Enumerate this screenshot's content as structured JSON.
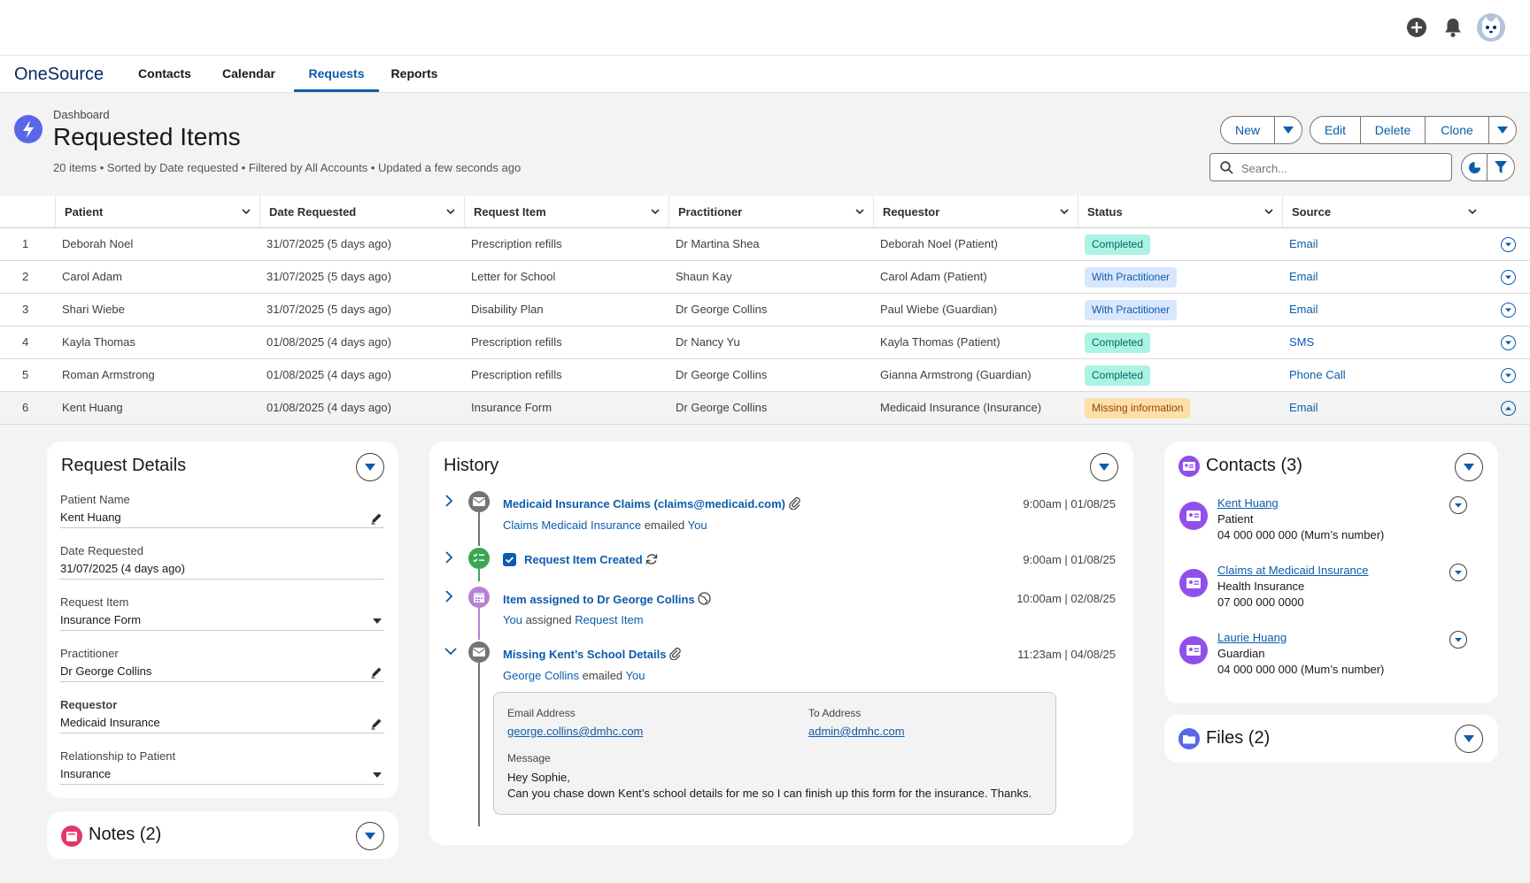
{
  "app": {
    "name": "OneSource"
  },
  "nav": {
    "tabs": [
      "Contacts",
      "Calendar",
      "Requests",
      "Reports"
    ],
    "active": "Requests"
  },
  "header_icons": [
    "add-icon",
    "bell-icon",
    "avatar"
  ],
  "page": {
    "breadcrumb": "Dashboard",
    "title": "Requested Items",
    "subtitle": "20 items • Sorted by Date requested  • Filtered by All Accounts • Updated a few seconds ago"
  },
  "actions": {
    "new": "New",
    "edit": "Edit",
    "delete": "Delete",
    "clone": "Clone"
  },
  "search": {
    "placeholder": "Search..."
  },
  "table": {
    "columns": [
      "Patient",
      "Date Requested",
      "Request Item",
      "Practitioner",
      "Requestor",
      "Status",
      "Source"
    ],
    "rows": [
      {
        "num": "1",
        "patient": "Deborah Noel",
        "date": "31/07/2025 (5 days ago)",
        "item": "Prescription refills",
        "practitioner": "Dr Martina Shea",
        "requestor": "Deborah Noel (Patient)",
        "status": "Completed",
        "source": "Email"
      },
      {
        "num": "2",
        "patient": "Carol Adam",
        "date": "31/07/2025 (5 days ago)",
        "item": "Letter for School",
        "practitioner": "Shaun Kay",
        "requestor": "Carol Adam (Patient)",
        "status": "With Practitioner",
        "source": "Email"
      },
      {
        "num": "3",
        "patient": "Shari Wiebe",
        "date": "31/07/2025 (5 days ago)",
        "item": "Disability Plan",
        "practitioner": "Dr George Collins",
        "requestor": "Paul Wiebe (Guardian)",
        "status": "With Practitioner",
        "source": "Email"
      },
      {
        "num": "4",
        "patient": "Kayla Thomas",
        "date": "01/08/2025 (4 days ago)",
        "item": "Prescription refills",
        "practitioner": "Dr Nancy Yu",
        "requestor": "Kayla Thomas (Patient)",
        "status": "Completed",
        "source": "SMS"
      },
      {
        "num": "5",
        "patient": "Roman Armstrong",
        "date": "01/08/2025 (4 days ago)",
        "item": "Prescription refills",
        "practitioner": "Dr George Collins",
        "requestor": "Gianna Armstrong (Guardian)",
        "status": "Completed",
        "source": "Phone Call"
      },
      {
        "num": "6",
        "patient": "Kent Huang",
        "date": "01/08/2025 (4 days ago)",
        "item": "Insurance Form",
        "practitioner": "Dr George Collins",
        "requestor": "Medicaid Insurance (Insurance)",
        "status": "Missing information",
        "source": "Email"
      }
    ]
  },
  "status_colors": {
    "Completed": {
      "bg": "#acf3e4",
      "fg": "#056764"
    },
    "With Practitioner": {
      "bg": "#d8e6fe",
      "fg": "#0b5cab"
    },
    "Missing information": {
      "bg": "#fedfa8",
      "fg": "#8c4b02"
    }
  },
  "request_details": {
    "title": "Request Details",
    "fields": [
      {
        "label": "Patient Name",
        "value": "Kent Huang",
        "icon": "pencil-icon"
      },
      {
        "label": "Date Requested",
        "value": "31/07/2025 (4 days ago)",
        "icon": ""
      },
      {
        "label": "Request Item",
        "value": "Insurance Form",
        "icon": "dropdown-icon"
      },
      {
        "label": "Practitioner",
        "value": "Dr George Collins",
        "icon": "pencil-icon"
      },
      {
        "label": "Requestor",
        "value": "Medicaid Insurance",
        "icon": "pencil-icon"
      },
      {
        "label": "Relationship to Patient",
        "value": "Insurance",
        "icon": "dropdown-icon"
      }
    ]
  },
  "notes": {
    "title": "Notes (2)"
  },
  "history": {
    "title": "History",
    "items": [
      {
        "title": "Medicaid Insurance Claims (claims@medicaid.com)",
        "sub_actor": "Claims Medicaid Insurance",
        "sub_verb": "emailed",
        "sub_target": "You",
        "time": "9:00am | 01/08/25",
        "icon": "email-icon",
        "title_icon": "attachment-icon"
      },
      {
        "title": "Request Item Created",
        "time": "9:00am | 01/08/25",
        "icon": "task-icon",
        "title_icon": "refresh-icon"
      },
      {
        "title": "Item assigned to Dr George Collins",
        "sub_actor": "You",
        "sub_verb": "assigned",
        "sub_target": "Request Item",
        "time": "10:00am | 02/08/25",
        "icon": "calendar-icon",
        "title_icon": "globe-icon"
      },
      {
        "title": "Missing Kent’s School Details",
        "sub_actor": "George Collins",
        "sub_verb": "emailed",
        "sub_target": "You",
        "time": "11:23am | 04/08/25",
        "icon": "email-icon",
        "title_icon": "attachment-icon"
      }
    ],
    "email": {
      "from_label": "Email Address",
      "from": "george.collins@dmhc.com",
      "to_label": "To Address",
      "to": "admin@dmhc.com",
      "message_label": "Message",
      "message_line1": "Hey Sophie,",
      "message_line2": "Can you chase down Kent’s school details for me so I can finish up this form for the insurance. Thanks."
    }
  },
  "contacts": {
    "title": "Contacts (3)",
    "items": [
      {
        "name": "Kent Huang",
        "role": "Patient",
        "phone": "04 000 000 000 (Mum’s number)"
      },
      {
        "name": "Claims at Medicaid Insurance",
        "role": "Health Insurance",
        "phone": "07 000 000 0000"
      },
      {
        "name": "Laurie Huang",
        "role": "Guardian",
        "phone": "04 000 000 000 (Mum’s number)"
      }
    ]
  },
  "files": {
    "title": "Files (2)"
  }
}
